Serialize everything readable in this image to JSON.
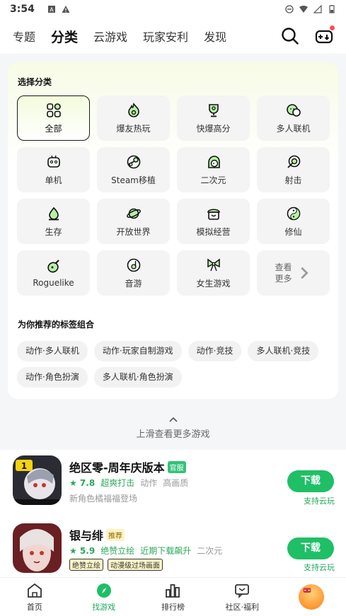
{
  "status_bar": {
    "time": "3:54"
  },
  "top_tabs": [
    {
      "label": "专题"
    },
    {
      "label": "分类",
      "active": true
    },
    {
      "label": "云游戏"
    },
    {
      "label": "玩家安利"
    },
    {
      "label": "发现"
    }
  ],
  "category_panel": {
    "title": "选择分类",
    "categories": [
      {
        "label": "全部",
        "icon": "grid-icon",
        "selected": true
      },
      {
        "label": "爆友热玩",
        "icon": "fire-icon"
      },
      {
        "label": "快爆高分",
        "icon": "trophy-icon"
      },
      {
        "label": "多人联机",
        "icon": "multiplayer-icon"
      },
      {
        "label": "单机",
        "icon": "gamepad-icon"
      },
      {
        "label": "Steam移植",
        "icon": "steam-icon"
      },
      {
        "label": "二次元",
        "icon": "anime-icon"
      },
      {
        "label": "射击",
        "icon": "target-icon"
      },
      {
        "label": "生存",
        "icon": "campfire-icon"
      },
      {
        "label": "开放世界",
        "icon": "planet-icon"
      },
      {
        "label": "模拟经营",
        "icon": "shop-icon"
      },
      {
        "label": "修仙",
        "icon": "yinyang-icon"
      },
      {
        "label": "Roguelike",
        "icon": "potion-icon"
      },
      {
        "label": "音游",
        "icon": "music-icon"
      },
      {
        "label": "女生游戏",
        "icon": "bow-icon"
      }
    ],
    "more": {
      "line1": "查看",
      "line2": "更多"
    },
    "tags_title": "为你推荐的标签组合",
    "tags": [
      "动作·多人联机",
      "动作·玩家自制游戏",
      "动作·竞技",
      "多人联机·竞技",
      "动作·角色扮演",
      "多人联机·角色扮演"
    ]
  },
  "pull_hint": "上滑查看更多游戏",
  "games": [
    {
      "title": "绝区零-周年庆版本",
      "badge": "官服",
      "rating": "★ 7.8",
      "highlight": "超爽打击",
      "tags": [
        "动作",
        "高画质"
      ],
      "subtitle": "新角色橘福福登场",
      "button": "下载",
      "cloud": "支持云玩"
    },
    {
      "title": "银与绯",
      "badge": "推荐",
      "rating": "★ 5.9",
      "highlight": "绝赞立绘",
      "highlight2": "近期下载飙升",
      "tags": [
        "二次元"
      ],
      "mini_tags": [
        "绝赞立绘",
        "动漫级过场画面"
      ],
      "button": "下载",
      "cloud": "支持云玩"
    }
  ],
  "bottom_nav": [
    {
      "label": "首页",
      "icon": "home-icon"
    },
    {
      "label": "找游戏",
      "icon": "compass-icon",
      "active": true
    },
    {
      "label": "排行榜",
      "icon": "ranking-icon"
    },
    {
      "label": "社区·福利",
      "icon": "community-icon"
    },
    {
      "label": "",
      "icon": "avatar-icon"
    }
  ],
  "colors": {
    "accent": "#1fbf66",
    "highlight": "#b7f0a7",
    "rating": "#2aa85a"
  }
}
